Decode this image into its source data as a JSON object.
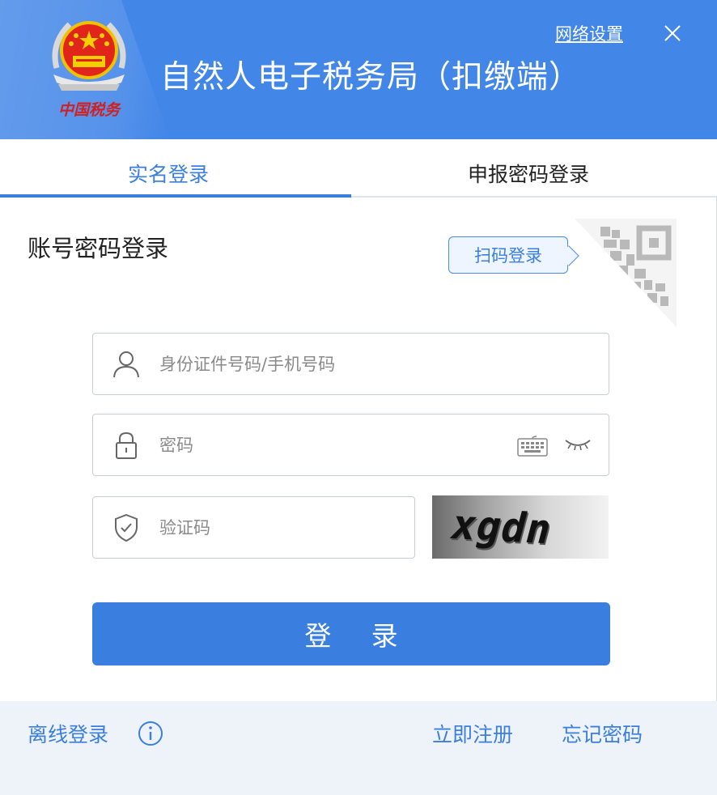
{
  "header": {
    "title": "自然人电子税务局（扣缴端）",
    "network_settings": "网络设置",
    "emblem_text": "中国税务",
    "brand_color": "#4286e8"
  },
  "tabs": [
    {
      "label": "实名登录",
      "active": true
    },
    {
      "label": "申报密码登录",
      "active": false
    }
  ],
  "login": {
    "section_title": "账号密码登录",
    "scan_login": "扫码登录",
    "username_placeholder": "身份证件号码/手机号码",
    "password_placeholder": "密码",
    "captcha_placeholder": "验证码",
    "captcha_value": "xgdn",
    "submit_label": "登 录"
  },
  "footer": {
    "offline_login": "离线登录",
    "register": "立即注册",
    "forgot_password": "忘记密码"
  },
  "icons": {
    "close": "close-icon",
    "user": "user-icon",
    "lock": "lock-icon",
    "shield": "shield-icon",
    "keyboard": "keyboard-icon",
    "eye": "eye-closed-icon",
    "info": "info-icon",
    "qr": "qr-code-icon"
  },
  "accent_color": "#3a7fe0"
}
